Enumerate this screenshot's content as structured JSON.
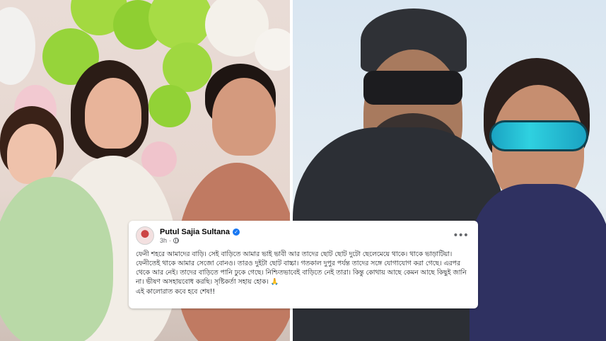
{
  "post": {
    "author": "Putul Sajia Sultana",
    "time": "3h",
    "separator": "·",
    "paragraphs": [
      "ফেনী শহরে আমাদের বাড়ি। সেই বাড়িতে আমার ভাই ভাবী আর তাদের ছোট ছোট দুটো ছেলেমেয়ে থাকে। থাকে ভাড়াটিয়া। ফেনীতেই থাকে আমার সেজো বোনও। তারও দুইটা ছোট বাচ্চা। গতকাল দুপুর পর্যন্ত তাদের সঙ্গে যোগাযোগ করা গেছে। এরপর থেকে আর নেই। তাদের বাড়িতে পানি ঢুকে গেছে। নিশ্চিতভাবেই বাড়িতে নেই তারা। কিন্তু কোথায় আছে কেমন আছে কিছুই জানি না। ভীষণ অসহায়বোধ করছি। সৃষ্টিকর্তা সহায় হোক। 🙏",
      "এই কালোরাত কবে হবে শেষ!!"
    ]
  },
  "icons": {
    "verified": "✓",
    "more": "•••"
  },
  "colors": {
    "verified_blue": "#1877f2",
    "meta_gray": "#65676b",
    "balloon_green": "#9bd63a",
    "balloon_pink": "#f2c9d1"
  }
}
